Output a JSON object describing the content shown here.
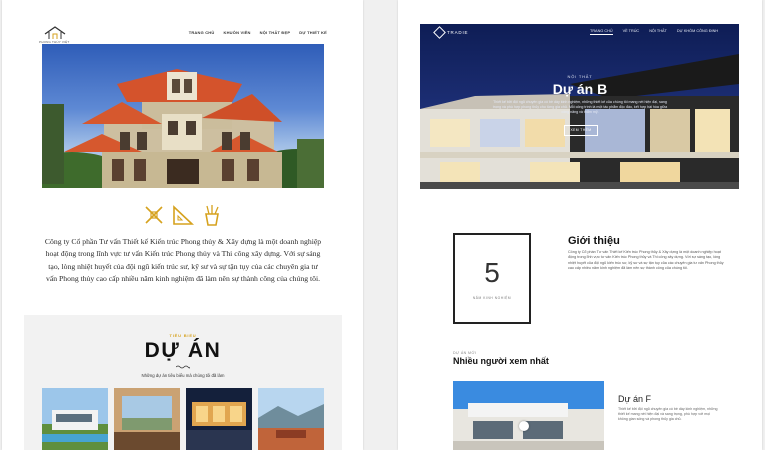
{
  "left": {
    "logo_text": "PHONG THỦY VIỆT",
    "nav": [
      "TRANG CHỦ",
      "KHUÔN VIÊN",
      "NỘI THẤT ĐẸP",
      "DỰ THIẾT KẾ"
    ],
    "description": "Công ty Cổ phần Tư vấn Thiết kế Kiến trúc Phong thủy & Xây dựng là một doanh nghiệp hoạt động trong lĩnh vực tư vấn Kiến trúc Phong thủy và Thi công xây dựng. Với sự sáng tạo, lòng nhiệt huyết của đội ngũ kiến trúc sư, kỹ sư và sự tận tụy của các chuyên gia tư vấn Phong thủy cao cấp nhiều năm kinh nghiệm đã làm nên sự thành công của chúng tôi.",
    "projects": {
      "eyebrow": "TIÊU BIỂU",
      "title": "DỰ ÁN",
      "subtitle": "Những dự án tiêu biểu mà chúng tôi đã làm"
    },
    "icons": [
      "drafting-tools-icon",
      "ruler-triangle-icon",
      "pen-cup-icon"
    ],
    "accent": "#d6a21e"
  },
  "right": {
    "logo_text": "TRADIE",
    "nav": [
      "TRANG CHỦ",
      "VỀ TRÚC",
      "NỘI THẤT",
      "DỰ KHÓM CÔNG ĐINH"
    ],
    "hero": {
      "eyebrow": "NỘI THẤT",
      "title": "Dự án B",
      "text": "Thiết kế bởi đội ngũ chuyên gia có bề dày kinh nghiệm, những thiết kế của chúng tôi mang nét hiện đại, sang trọng và phù hợp phong thủy cho từng gia chủ. Mỗi công trình là một tác phẩm độc đáo, kết hợp hài hòa giữa công năng và thẩm mỹ.",
      "button": "XEM THÊM"
    },
    "stat": {
      "number": "5",
      "label": "NĂM KINH NGHIỆM"
    },
    "intro": {
      "title": "Giới thiệu",
      "text": "Công ty Cổ phần Tư vấn Thiết kế Kiến trúc Phong thủy & Xây dựng là một doanh nghiệp hoạt động trong lĩnh vực tư vấn Kiến trúc Phong thủy và Thi công xây dựng. Với sự sáng tạo, lòng nhiệt huyết của đội ngũ kiến trúc sư, kỹ sư và sự tận tụy của các chuyên gia tư vấn Phong thủy cao cấp nhiều năm kinh nghiệm đã làm nên sự thành công của chúng tôi."
    },
    "most_viewed": {
      "eyebrow": "DỰ ÁN MỚI",
      "title": "Nhiều người xem nhất",
      "project_title": "Dự án F",
      "project_text": "Thiết kế bởi đội ngũ chuyên gia có bề dày kinh nghiệm, những thiết kế mang nét hiện đại và sang trọng, phù hợp với mọi không gian sống và phong thủy gia chủ."
    }
  }
}
